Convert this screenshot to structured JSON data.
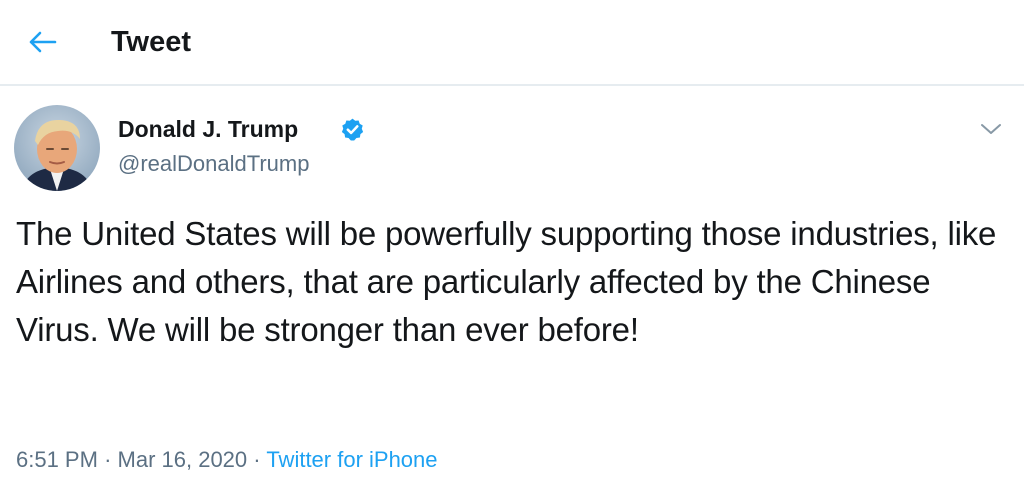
{
  "header": {
    "back_icon": "arrow-left-icon",
    "title": "Tweet"
  },
  "tweet": {
    "author": {
      "display_name": "Donald J. Trump",
      "handle": "@realDonaldTrump",
      "verified": true,
      "verified_icon": "verified-badge-icon"
    },
    "menu_icon": "chevron-down-icon",
    "text": "The United States will be powerfully supporting those industries, like Airlines and others, that are particularly affected by the Chinese Virus. We will be stronger than ever before!",
    "time": "6:51 PM",
    "separator": "·",
    "date": "Mar 16, 2020",
    "source": "Twitter for iPhone"
  },
  "colors": {
    "accent": "#1da1f2",
    "text_primary": "#14171a",
    "text_secondary": "#5b7083",
    "divider": "#e6ecf0"
  }
}
